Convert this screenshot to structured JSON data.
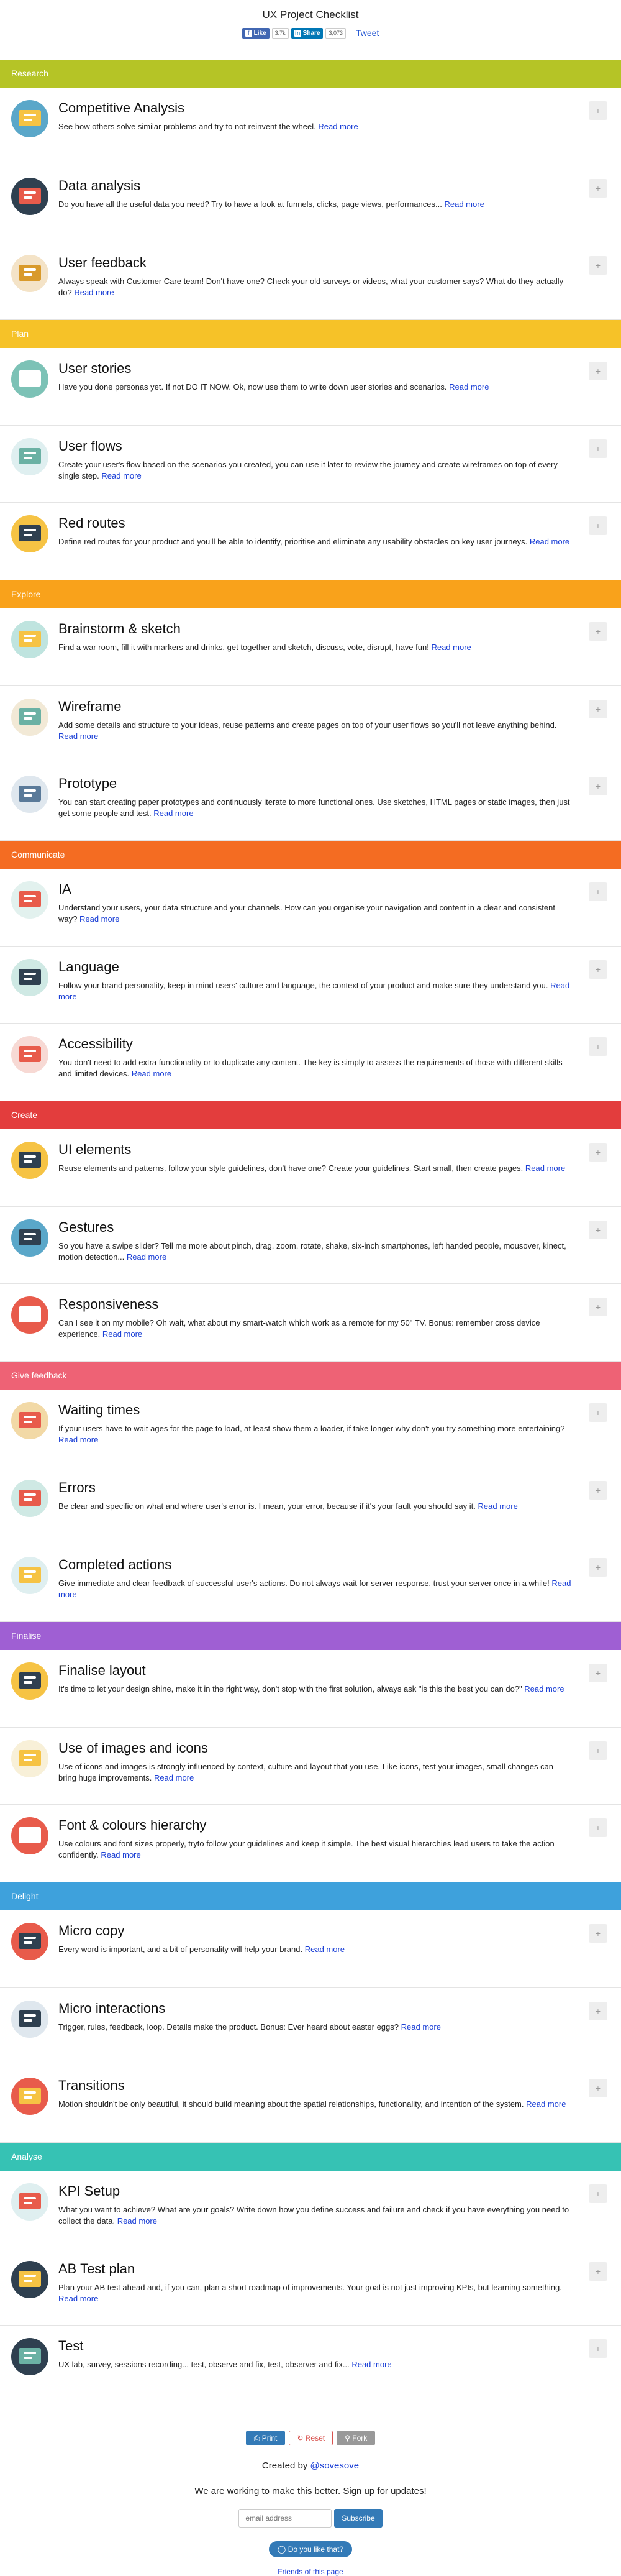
{
  "header": {
    "title": "UX Project Checklist",
    "fb_like": "Like",
    "fb_count": "3.7k",
    "li_share": "Share",
    "li_count": "3,073",
    "tweet": "Tweet"
  },
  "read_more": "Read more",
  "plus": "+",
  "sections": [
    {
      "name": "Research",
      "color": "#b5c426",
      "items": [
        {
          "title": "Competitive Analysis",
          "desc": "See how others solve similar problems and try to not reinvent the wheel.",
          "icon": "research-icon",
          "bg": "#5aa7c9",
          "fg": "#f6c344"
        },
        {
          "title": "Data analysis",
          "desc": "Do you have all the useful data you need? Try to have a look at funnels, clicks, page views, performances...",
          "icon": "chart-screen-icon",
          "bg": "#2f4050",
          "fg": "#e85b4b"
        },
        {
          "title": "User feedback",
          "desc": "Always speak with Customer Care team! Don't have one? Check your old surveys or videos, what your customer says? What do they actually do?",
          "icon": "feedback-icon",
          "bg": "#f4e3c7",
          "fg": "#d99a2b"
        }
      ]
    },
    {
      "name": "Plan",
      "color": "#f6c228",
      "items": [
        {
          "title": "User stories",
          "desc": "Have you done personas yet. If not DO IT NOW. Ok, now use them to write down user stories and scenarios.",
          "icon": "persona-icon",
          "bg": "#7cc2b6",
          "fg": "#ffffff"
        },
        {
          "title": "User flows",
          "desc": "Create your user's flow based on the scenarios you created, you can use it later to review the journey and create wireframes on top of every single step.",
          "icon": "flow-icon",
          "bg": "#dfeff0",
          "fg": "#6bb1a4"
        },
        {
          "title": "Red routes",
          "desc": "Define red routes for your product and you'll be able to identify, prioritise and eliminate any usability obstacles on key user journeys.",
          "icon": "route-icon",
          "bg": "#f6c344",
          "fg": "#2f4050"
        }
      ]
    },
    {
      "name": "Explore",
      "color": "#f9a21b",
      "items": [
        {
          "title": "Brainstorm & sketch",
          "desc": "Find a war room, fill it with markers and drinks, get together and sketch, discuss, vote, disrupt, have fun!",
          "icon": "beer-icon",
          "bg": "#bfe4df",
          "fg": "#f6c344"
        },
        {
          "title": "Wireframe",
          "desc": "Add some details and structure to your ideas, reuse patterns and create pages on top of your user flows so you'll not leave anything behind.",
          "icon": "wireframe-icon",
          "bg": "#f2e9d6",
          "fg": "#6bb1a4"
        },
        {
          "title": "Prototype",
          "desc": "You can start creating paper prototypes and continuously iterate to more functional ones. Use sketches, HTML pages or static images, then just get some people and test.",
          "icon": "prototype-icon",
          "bg": "#dfe7ee",
          "fg": "#5a7a99"
        }
      ]
    },
    {
      "name": "Communicate",
      "color": "#f46c22",
      "items": [
        {
          "title": "IA",
          "desc": "Understand your users, your data structure and your channels. How can you organise your navigation and content in a clear and consistent way?",
          "icon": "sitemap-icon",
          "bg": "#e2f1ee",
          "fg": "#e85b4b"
        },
        {
          "title": "Language",
          "desc": "Follow your brand personality, keep in mind users' culture and language, the context of your product and make sure they understand you.",
          "icon": "keyboard-icon",
          "bg": "#cfe9e4",
          "fg": "#2f4050"
        },
        {
          "title": "Accessibility",
          "desc": "You don't need to add extra functionality or to duplicate any content. The key is simply to assess the requirements of those with different skills and limited devices.",
          "icon": "wheelchair-icon",
          "bg": "#f7d9d4",
          "fg": "#e85b4b"
        }
      ]
    },
    {
      "name": "Create",
      "color": "#e33d3d",
      "items": [
        {
          "title": "UI elements",
          "desc": "Reuse elements and patterns, follow your style guidelines, don't have one? Create your guidelines. Start small, then create pages.",
          "icon": "ui-icon",
          "bg": "#f6c344",
          "fg": "#2f4050"
        },
        {
          "title": "Gestures",
          "desc": "So you have a swipe slider? Tell me more about pinch, drag, zoom, rotate, shake, six-inch smartphones, left handed people, mousover, kinect, motion detection...",
          "icon": "phone-icon",
          "bg": "#5aa7c9",
          "fg": "#2f4050"
        },
        {
          "title": "Responsiveness",
          "desc": "Can I see it on my mobile? Oh wait, what about my smart-watch which work as a remote for my 50\" TV. Bonus: remember cross device experience.",
          "icon": "devices-icon",
          "bg": "#e85b4b",
          "fg": "#ffffff"
        }
      ]
    },
    {
      "name": "Give feedback",
      "color": "#ee6275",
      "items": [
        {
          "title": "Waiting times",
          "desc": "If your users have to wait ages for the page to load, at least show them a loader, if take longer why don't you try something more entertaining?",
          "icon": "clock-icon",
          "bg": "#f2d9a6",
          "fg": "#e85b4b"
        },
        {
          "title": "Errors",
          "desc": "Be clear and specific on what and where user's error is. I mean, your error, because if it's your fault you should say it.",
          "icon": "error-icon",
          "bg": "#cfe9e4",
          "fg": "#e85b4b"
        },
        {
          "title": "Completed actions",
          "desc": "Give immediate and clear feedback of successful user's actions. Do not always wait for server response, trust your server once in a while!",
          "icon": "completed-icon",
          "bg": "#dfeff0",
          "fg": "#f6c344"
        }
      ]
    },
    {
      "name": "Finalise",
      "color": "#9f5fd3",
      "items": [
        {
          "title": "Finalise layout",
          "desc": "It's time to let your design shine, make it in the right way, don't stop with the first solution, always ask \"is this the best you can do?\"",
          "icon": "layout-icon",
          "bg": "#f6c344",
          "fg": "#2f4050"
        },
        {
          "title": "Use of images and icons",
          "desc": "Use of icons and images is strongly influenced by context, culture and layout that you use. Like icons, test your images, small changes can bring huge improvements.",
          "icon": "cart-icon",
          "bg": "#f8f0d8",
          "fg": "#f6c344"
        },
        {
          "title": "Font & colours hierarchy",
          "desc": "Use colours and font sizes properly, tryto follow your guidelines and keep it simple. The best visual hierarchies lead users to take the action confidently.",
          "icon": "font-icon",
          "bg": "#e85b4b",
          "fg": "#ffffff"
        }
      ]
    },
    {
      "name": "Delight",
      "color": "#3ea1dc",
      "items": [
        {
          "title": "Micro copy",
          "desc": "Every word is important, and a bit of personality will help your brand.",
          "icon": "copy-icon",
          "bg": "#e85b4b",
          "fg": "#2f4050"
        },
        {
          "title": "Micro interactions",
          "desc": "Trigger, rules, feedback, loop. Details make the product. Bonus: Ever heard about easter eggs?",
          "icon": "magnifier-icon",
          "bg": "#dfe7ee",
          "fg": "#2f4050"
        },
        {
          "title": "Transitions",
          "desc": "Motion shouldn't be only beautiful, it should build meaning about the spatial relationships, functionality, and intention of the system.",
          "icon": "transition-icon",
          "bg": "#e85b4b",
          "fg": "#f6c344"
        }
      ]
    },
    {
      "name": "Analyse",
      "color": "#36c2b4",
      "items": [
        {
          "title": "KPI Setup",
          "desc": "What you want to achieve? What are your goals? Write down how you define success and failure and check if you have everything you need to collect the data.",
          "icon": "target-icon",
          "bg": "#dfeff0",
          "fg": "#e85b4b"
        },
        {
          "title": "AB Test plan",
          "desc": "Plan your AB test ahead and, if you can, plan a short roadmap of improvements. Your goal is not just improving KPIs, but learning something.",
          "icon": "abtest-icon",
          "bg": "#2f4050",
          "fg": "#f6c344"
        },
        {
          "title": "Test",
          "desc": "UX lab, survey, sessions recording... test, observe and fix, test, observer and fix...",
          "icon": "test-icon",
          "bg": "#2f4050",
          "fg": "#6bb1a4"
        }
      ]
    }
  ],
  "footer": {
    "print": "Print",
    "reset": "Reset",
    "fork": "Fork",
    "created_by": "Created by",
    "author": "@sovesove",
    "working": "We are working to make this better. Sign up for updates!",
    "email_placeholder": "email address",
    "subscribe": "Subscribe",
    "like": "Do you like that?",
    "friends": "Friends of this page"
  }
}
